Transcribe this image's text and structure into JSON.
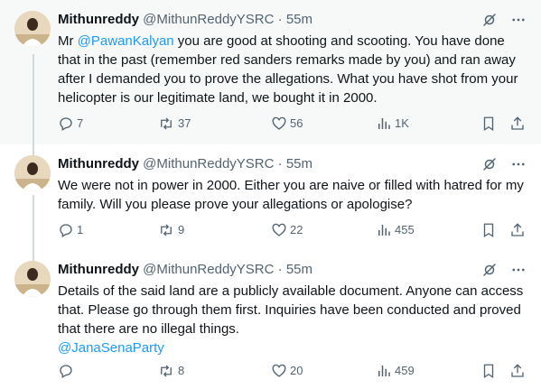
{
  "tweets": [
    {
      "name": "Mithunreddy",
      "handle": "@MithunReddyYSRC",
      "dot": "·",
      "time": "55m",
      "text_pre": "Mr ",
      "mention": "@PawanKalyan",
      "text_post": " you are good at shooting and scooting. You have done that in the past (remember red sanders remarks made by you) and ran away after I demanded you to prove the allegations. What you have shot from your helicopter is our legitimate land, we bought it in 2000.",
      "replies": "7",
      "reposts": "37",
      "likes": "56",
      "views": "1K"
    },
    {
      "name": "Mithunreddy",
      "handle": "@MithunReddyYSRC",
      "dot": "·",
      "time": "55m",
      "text": "We were not in power in 2000. Either you are naive or filled with hatred for my family. Will you please prove your allegations or apologise?",
      "replies": "1",
      "reposts": "9",
      "likes": "22",
      "views": "455"
    },
    {
      "name": "Mithunreddy",
      "handle": "@MithunReddyYSRC",
      "dot": "·",
      "time": "55m",
      "text": "Details of the said land are a publicly available document. Anyone can access that. Please go through them first. Inquiries have been conducted and proved that there are no illegal things.",
      "mention": "@JanaSenaParty",
      "replies": "",
      "reposts": "8",
      "likes": "20",
      "views": "459"
    }
  ],
  "icons": {
    "grok": "grok-icon",
    "more": "more-icon",
    "reply": "reply-icon",
    "repost": "repost-icon",
    "like": "like-icon",
    "views": "views-icon",
    "bookmark": "bookmark-icon",
    "share": "share-icon"
  },
  "colors": {
    "text": "#0f1419",
    "secondary": "#536471",
    "link": "#1d9bf0",
    "highlight_bg": "#f7f9f9",
    "thread_line": "#cfd9de"
  }
}
